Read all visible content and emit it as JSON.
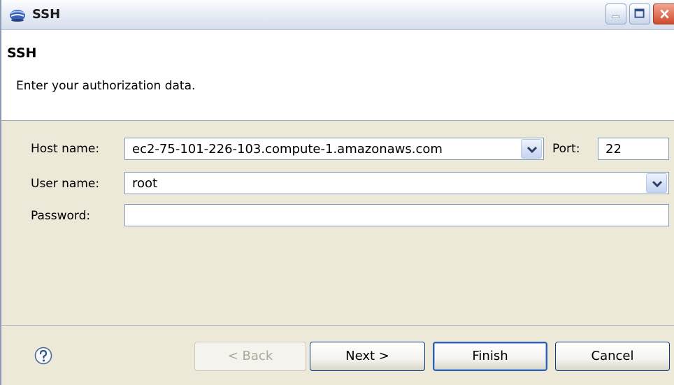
{
  "window": {
    "title": "SSH",
    "controls": {
      "minimize": "minimize-icon",
      "maximize": "maximize-icon",
      "close": "close-icon"
    }
  },
  "header": {
    "title": "SSH",
    "message": "Enter your authorization data."
  },
  "form": {
    "host_label": "Host name:",
    "host_value": "ec2-75-101-226-103.compute-1.amazonaws.com",
    "port_label": "Port:",
    "port_value": "22",
    "user_label": "User name:",
    "user_value": "root",
    "password_label": "Password:",
    "password_value": ""
  },
  "buttons": {
    "back": "< Back",
    "next": "Next >",
    "finish": "Finish",
    "cancel": "Cancel"
  },
  "icons": {
    "app": "java-cup-icon",
    "help": "help-icon",
    "dropdown": "chevron-down-icon"
  },
  "colors": {
    "accent": "#2f5fb0",
    "field_border": "#7f9db9",
    "dialog_bg": "#ece9d8"
  }
}
